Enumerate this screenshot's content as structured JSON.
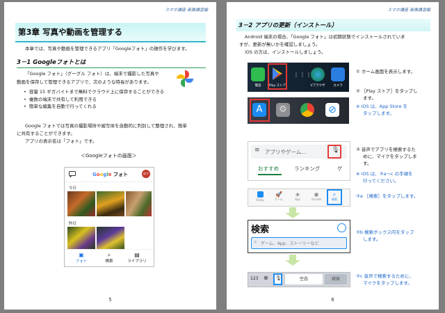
{
  "left": {
    "header": "スマホ講座 画像講習編",
    "chapter_title": "第3章 写真や動画を管理する",
    "intro": "本章では、写真や動画を管理できるアプリ「Googleフォト」の操作を学びます。",
    "section_title": "3－1 Googleフォトとは",
    "para1_line1": "「Google フォト」（グーグル フォト）は、端末で撮影した写真や",
    "para1_line2": "動画を保存して管理できるアプリで、次のような特長があります。",
    "bullets": [
      "容量 15 ギガバイトまで無料でクラウド上に保存することができる",
      "複数の端末で共有して利用できる",
      "簡単な編集を自動で行ってくれる"
    ],
    "para2_line1": "Google フォトでは写真の撮影場所や被写体を自動的に判別して整理され、簡単",
    "para2_line2": "に共有することができます。",
    "para3": "アプリの表示名は「フォト」です。",
    "caption": "＜Googleフォトの画面＞",
    "phone": {
      "title_prefix": "フォト",
      "avatar": "佐子",
      "date1": "今日",
      "date2": "昨日",
      "nav": [
        "フォト",
        "検索",
        "ライブラリ"
      ]
    },
    "page_number": "5"
  },
  "right": {
    "header": "スマホ講座 画像講習編",
    "section_title": "3－2 アプリの更新（インストール）",
    "para1_line1": "Android 端末の場合、「Google フォト」は初期状態でインストールされていま",
    "para1_line2": "すが、更新が無いかを確認しましょう。",
    "para2": "iOS の方は、インストールしましょう。",
    "home_icons": [
      "電話",
      "Play ストア",
      "",
      "Vブラウザ",
      "カメラ"
    ],
    "step1": "① ホーム画面を表示します。",
    "step2_l1": "② ［Play ストア］をタップし",
    "step2_l2": "ます。",
    "note2_l1": "※ iOS は、App Store を",
    "note2_l2": "タップします。",
    "search_placeholder": "アプリやゲーム...",
    "tabs": [
      "おすすめ",
      "ランキング",
      "ゲ"
    ],
    "ios_tabs": [
      "Today",
      "ゲーム",
      "App",
      "Arcade",
      "検索"
    ],
    "step3_l1": "③ 音声でアプリを検索するた",
    "step3_l2": "めに、マイクをタップしま",
    "step3_l3": "す。",
    "note3_l1": "※ iOS は、③a～c の手順を",
    "note3_l2": "行ってください。",
    "step3a": "③a ［検索］をタップします。",
    "search_title": "検索",
    "search_box": "ゲーム、App、ストーリーなど",
    "step3b_l1": "③b 検索ボックス内をタップ",
    "step3b_l2": "します。",
    "kb_123": "123",
    "kb_space": "空白",
    "kb_search": "検索",
    "step3c_l1": "③c 音声で検索するために、",
    "step3c_l2": "マイクをタップします。",
    "page_number": "6"
  }
}
